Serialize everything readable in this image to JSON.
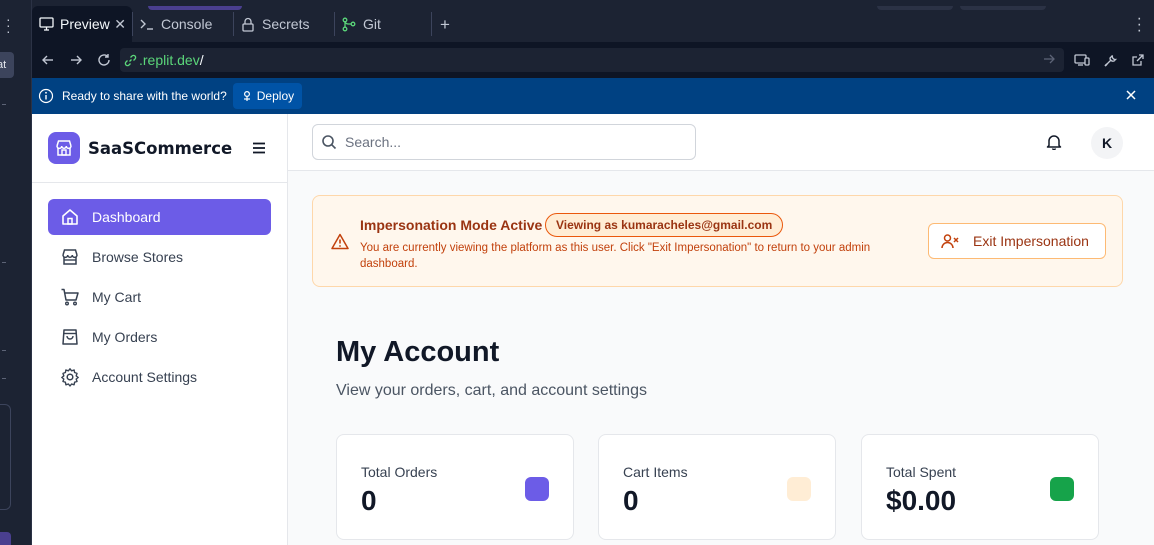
{
  "ide": {
    "left_chip_text": "at",
    "tabs": [
      {
        "label": "Preview",
        "icon": "monitor-icon",
        "close": "✕"
      },
      {
        "label": "Console",
        "icon": "terminal-icon"
      },
      {
        "label": "Secrets",
        "icon": "lock-icon"
      },
      {
        "label": "Git",
        "icon": "git-icon"
      }
    ],
    "add_tab": "+",
    "url": {
      "host": ".replit.dev",
      "path": "/"
    },
    "banner": {
      "message": "Ready to share with the world?",
      "deploy_label": "Deploy"
    }
  },
  "colors": {
    "ide_bg": "#1c2333",
    "banner_bg": "#004182",
    "accent": "#6c5ce7",
    "warning_bg": "#fff7ed",
    "warning_text": "#9a3412"
  },
  "sidebar": {
    "brand": "SaaSCommerce",
    "items": [
      {
        "label": "Dashboard",
        "icon": "home-icon",
        "active": true
      },
      {
        "label": "Browse Stores",
        "icon": "store-icon"
      },
      {
        "label": "My Cart",
        "icon": "cart-icon"
      },
      {
        "label": "My Orders",
        "icon": "bag-icon"
      },
      {
        "label": "Account Settings",
        "icon": "gear-icon"
      }
    ]
  },
  "header": {
    "search_placeholder": "Search...",
    "avatar_initial": "K"
  },
  "impersonation": {
    "title": "Impersonation Mode Active",
    "badge": "Viewing as kumaracheles@gmail.com",
    "description": "You are currently viewing the platform as this user. Click \"Exit Impersonation\" to return to your admin dashboard.",
    "exit_label": "Exit Impersonation"
  },
  "page": {
    "title": "My Account",
    "subtitle": "View your orders, cart, and account settings"
  },
  "stats": [
    {
      "label": "Total Orders",
      "value": "0",
      "color": "#6c5ce7"
    },
    {
      "label": "Cart Items",
      "value": "0",
      "color": "#ffedd5"
    },
    {
      "label": "Total Spent",
      "value": "$0.00",
      "color": "#16a34a"
    }
  ]
}
